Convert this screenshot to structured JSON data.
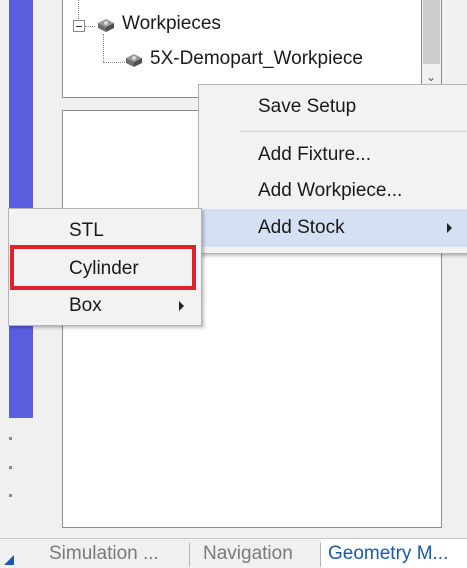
{
  "tree": {
    "root_label": "Workpieces",
    "child_label": "5X-Demopart_Workpiece"
  },
  "context_menu": {
    "items": [
      {
        "label": "Save Setup"
      },
      {
        "label": "Add Fixture..."
      },
      {
        "label": "Add Workpiece..."
      },
      {
        "label": "Add Stock"
      }
    ]
  },
  "stock_submenu": {
    "items": [
      {
        "label": "STL"
      },
      {
        "label": "Cylinder"
      },
      {
        "label": "Box"
      }
    ]
  },
  "tabs": [
    {
      "label": "Simulation ...",
      "active": false
    },
    {
      "label": "Navigation",
      "active": false
    },
    {
      "label": "Geometry M...",
      "active": true
    }
  ],
  "colors": {
    "accent_strip": "#5a5ede",
    "highlight": "#e3202a",
    "active_tab_text": "#1a5aa8",
    "inactive_tab_text": "#7a7a7a"
  }
}
